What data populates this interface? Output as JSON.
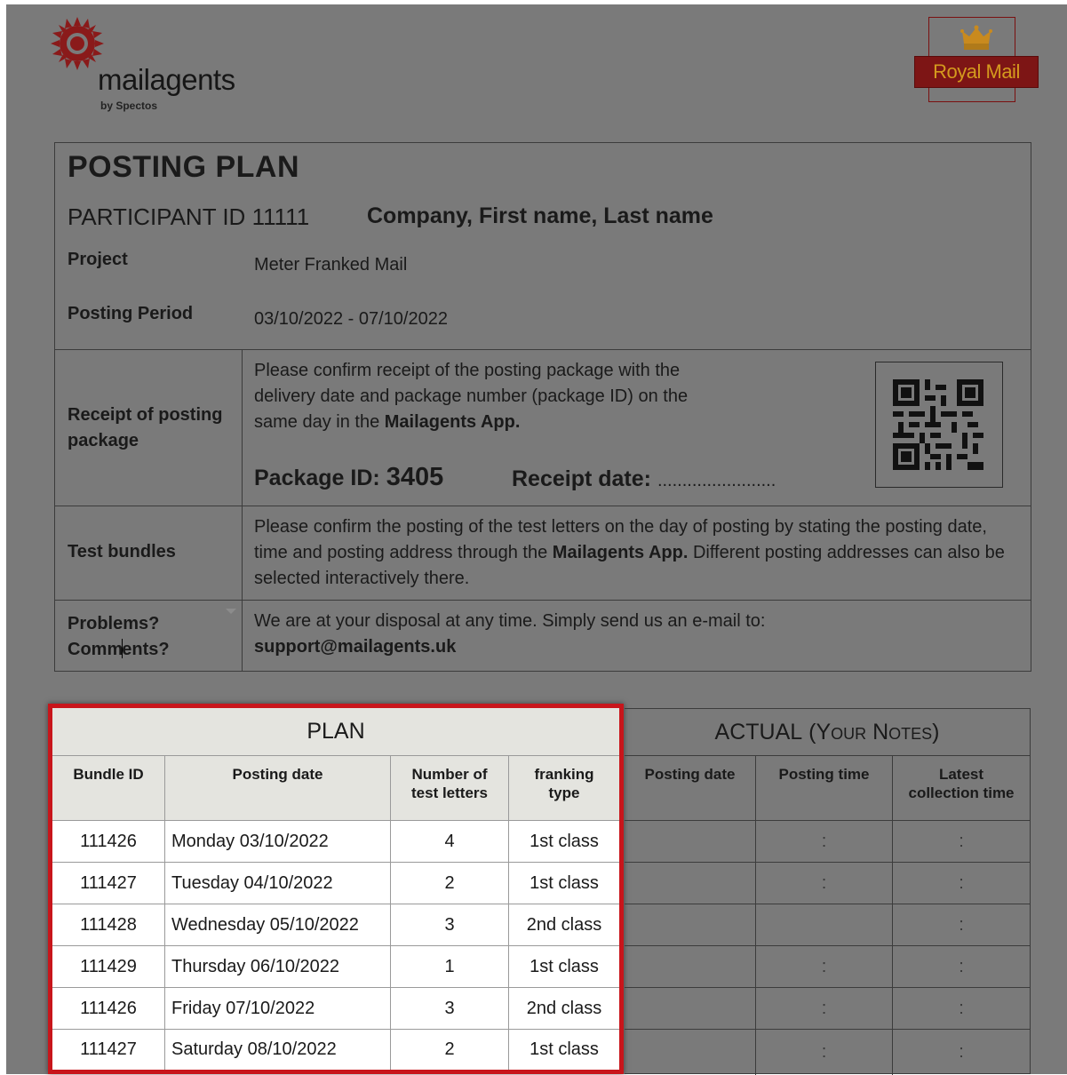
{
  "logos": {
    "mailagents_name": "mailagents",
    "mailagents_tagline": "by Spectos",
    "royal_mail": "Royal Mail"
  },
  "plan_info": {
    "title": "POSTING PLAN",
    "participant_label": "PARTICIPANT ID",
    "participant_id": "11111",
    "participant_name": "Company, First name, Last name",
    "project_label": "Project",
    "project_value": "Meter Franked Mail",
    "period_label": "Posting Period",
    "period_value": "03/10/2022 - 07/10/2022",
    "receipt_label": "Receipt of posting package",
    "receipt_text": "Please confirm receipt of the posting package with the delivery date and package number (package ID) on the same day in the",
    "app_name": "Mailagents App.",
    "package_id_label": "Package ID:",
    "package_id": "3405",
    "receipt_date_label": "Receipt date:",
    "receipt_date_blank": "........................",
    "bundles_label": "Test bundles",
    "bundles_text_before": "Please confirm the posting of the test letters on the day of posting by stating the posting date, time and posting address through the",
    "bundles_text_after": "Different posting addresses can also be selected interactively there.",
    "problems_label_1": "Problems?",
    "problems_label_2a": "Comm",
    "problems_label_2b": "ents?",
    "problems_text": "We are at your disposal at any time. Simply send us an e-mail to:",
    "support_email": "support@mailagents.uk"
  },
  "plan_table": {
    "title": "PLAN",
    "headers": [
      "Bundle ID",
      "Posting date",
      "Number of test letters",
      "franking type"
    ],
    "rows": [
      {
        "bundle_id": "111426",
        "date": "Monday 03/10/2022",
        "letters": "4",
        "type": "1st class"
      },
      {
        "bundle_id": "111427",
        "date": "Tuesday 04/10/2022",
        "letters": "2",
        "type": "1st class"
      },
      {
        "bundle_id": "111428",
        "date": "Wednesday 05/10/2022",
        "letters": "3",
        "type": "2nd class"
      },
      {
        "bundle_id": "111429",
        "date": "Thursday 06/10/2022",
        "letters": "1",
        "type": "1st class"
      },
      {
        "bundle_id": "111426",
        "date": "Friday 07/10/2022",
        "letters": "3",
        "type": "2nd class"
      },
      {
        "bundle_id": "111427",
        "date": "Saturday 08/10/2022",
        "letters": "2",
        "type": "1st class"
      }
    ]
  },
  "actual_table": {
    "title": "ACTUAL",
    "title_note": "(Your Notes)",
    "headers": [
      "Posting date",
      "Posting time",
      "Latest collection time"
    ],
    "rows": [
      {
        "time": ":",
        "collection": ":"
      },
      {
        "time": ":",
        "collection": ":"
      },
      {
        "time": "",
        "collection": ":"
      },
      {
        "time": ":",
        "collection": ":"
      },
      {
        "time": ":",
        "collection": ":"
      },
      {
        "time": ":",
        "collection": ":"
      }
    ]
  },
  "icons": [
    "mailagents-sun-logo",
    "royal-mail-crown",
    "qr-code"
  ]
}
